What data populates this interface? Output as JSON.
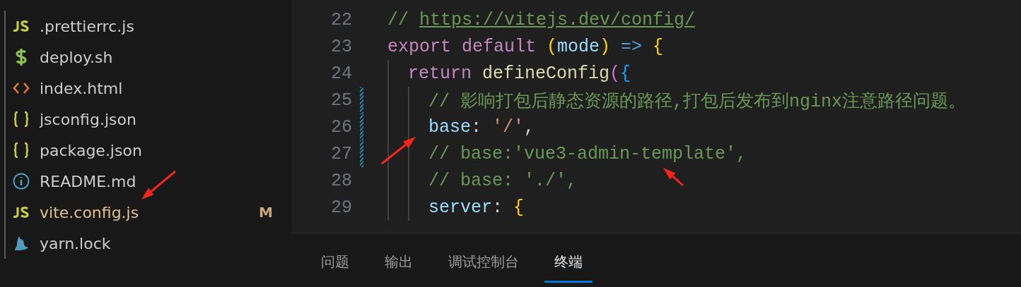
{
  "explorer": {
    "files": [
      {
        "name": ".prettierrc.js",
        "kind": "js",
        "modified": false
      },
      {
        "name": "deploy.sh",
        "kind": "shell",
        "modified": false
      },
      {
        "name": "index.html",
        "kind": "html",
        "modified": false
      },
      {
        "name": "jsconfig.json",
        "kind": "json",
        "modified": false
      },
      {
        "name": "package.json",
        "kind": "json",
        "modified": false
      },
      {
        "name": "README.md",
        "kind": "info",
        "modified": false
      },
      {
        "name": "vite.config.js",
        "kind": "js",
        "modified": true,
        "status": "M"
      },
      {
        "name": "yarn.lock",
        "kind": "yarn",
        "modified": false
      }
    ]
  },
  "editor": {
    "lines": [
      {
        "number": "22",
        "changed": false,
        "tokens": [
          {
            "kind": "comment",
            "text": "// "
          },
          {
            "kind": "link",
            "text": "https://vitejs.dev/config/"
          }
        ]
      },
      {
        "number": "23",
        "changed": false,
        "tokens": [
          {
            "kind": "keyword",
            "text": "export default "
          },
          {
            "kind": "bracket1",
            "text": "("
          },
          {
            "kind": "variable",
            "text": "mode"
          },
          {
            "kind": "bracket1",
            "text": ")"
          },
          {
            "kind": "operator",
            "text": " => "
          },
          {
            "kind": "bracket1",
            "text": "{"
          }
        ],
        "children": [
          {
            "number": "24",
            "changed": false,
            "tokens": [
              {
                "kind": "keyword",
                "text": "return "
              },
              {
                "kind": "function",
                "text": "defineConfig"
              },
              {
                "kind": "bracket2",
                "text": "("
              },
              {
                "kind": "bracket3",
                "text": "{"
              }
            ],
            "children": [
              {
                "number": "25",
                "changed": true,
                "tokens": [
                  {
                    "kind": "comment",
                    "text": "// 影响打包后静态资源的路径,打包后发布到nginx注意路径问题。"
                  }
                ]
              },
              {
                "number": "26",
                "changed": true,
                "tokens": [
                  {
                    "kind": "variable",
                    "text": "base"
                  },
                  {
                    "kind": "plain",
                    "text": ": "
                  },
                  {
                    "kind": "string",
                    "text": "'/'"
                  },
                  {
                    "kind": "plain",
                    "text": ","
                  }
                ]
              },
              {
                "number": "27",
                "changed": true,
                "tokens": [
                  {
                    "kind": "comment",
                    "text": "// base:'vue3-admin-template',"
                  }
                ]
              },
              {
                "number": "28",
                "changed": false,
                "tokens": [
                  {
                    "kind": "comment",
                    "text": "// base: './',"
                  }
                ]
              },
              {
                "number": "29",
                "changed": false,
                "tokens": [
                  {
                    "kind": "variable",
                    "text": "server"
                  },
                  {
                    "kind": "plain",
                    "text": ": "
                  },
                  {
                    "kind": "bracket1",
                    "text": "{"
                  }
                ]
              }
            ]
          }
        ]
      }
    ]
  },
  "panel": {
    "tabs": [
      {
        "label": "问题",
        "selected": false
      },
      {
        "label": "输出",
        "selected": false
      },
      {
        "label": "调试控制台",
        "selected": false
      },
      {
        "label": "终端",
        "selected": true
      }
    ]
  }
}
